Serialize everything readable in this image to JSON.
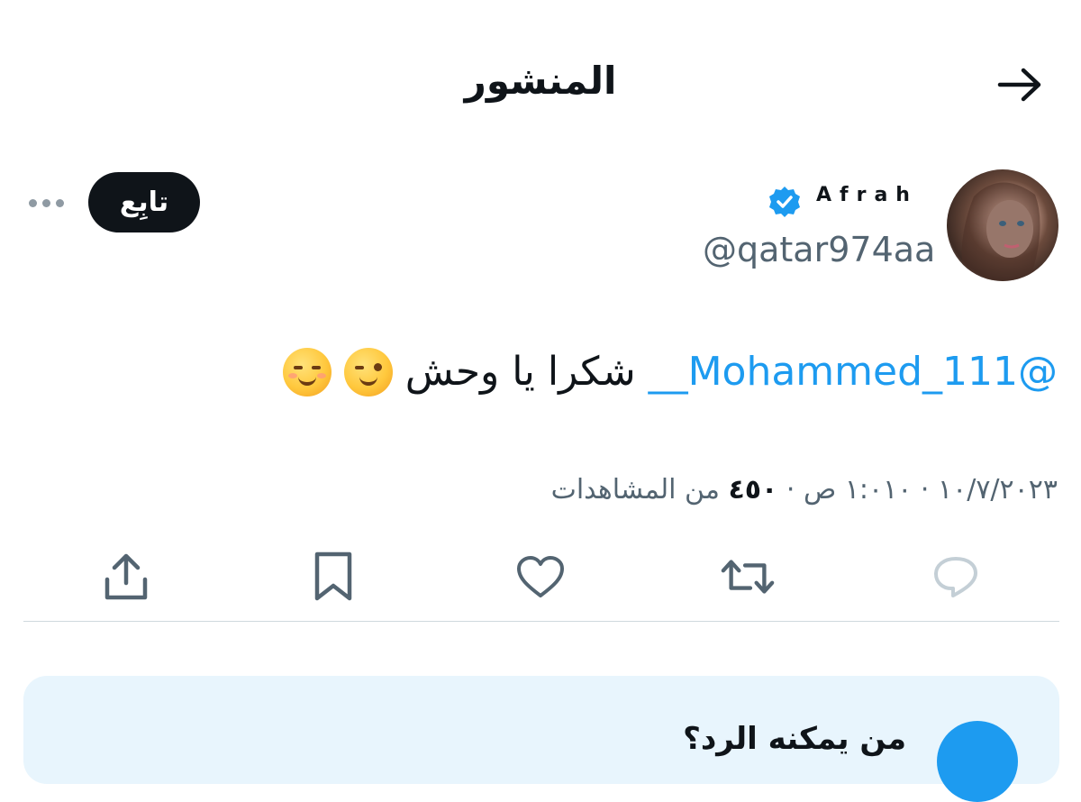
{
  "header": {
    "title": "المنشور",
    "back_icon": "arrow-right-icon"
  },
  "author": {
    "display_name": "Afrah",
    "handle": "@qatar974aa",
    "verified": true,
    "verified_color": "#1d9bf0"
  },
  "follow_button": {
    "label": "تابِع"
  },
  "tweet": {
    "mention": "@Mohammed_111__",
    "text": "شكرا يا وحش",
    "emojis": [
      "winking-face-emoji",
      "relieved-face-emoji"
    ]
  },
  "meta": {
    "datetime": "١٠/٧/٢٠٢٣ · ١:٠١٠ ص ·",
    "views_count": "٤٥٠",
    "views_label": "من المشاهدات"
  },
  "actions": {
    "reply": "reply-icon",
    "repost": "repost-icon",
    "like": "like-icon",
    "bookmark": "bookmark-icon",
    "share": "share-icon"
  },
  "reply_settings": {
    "title": "من يمكنه الرد؟"
  },
  "colors": {
    "accent": "#1d9bf0",
    "text_primary": "#0f1419",
    "text_secondary": "#536471",
    "card_bg": "#e8f5fd"
  }
}
